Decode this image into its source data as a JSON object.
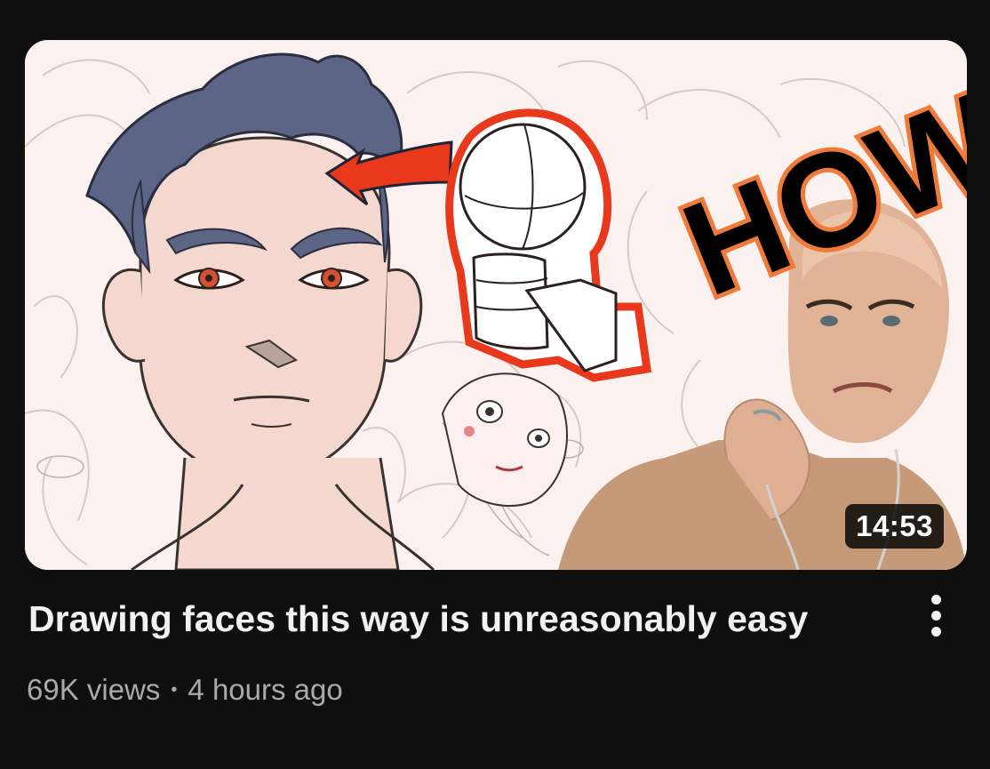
{
  "video": {
    "title": "Drawing faces this way is unreasonably easy",
    "views": "69K views",
    "separator": "•",
    "age": "4 hours ago",
    "duration": "14:53",
    "thumbnail_overlay_text": "HOW"
  },
  "icons": {
    "menu": "more-vert-icon"
  },
  "colors": {
    "background": "#0f0f0f",
    "title": "#f1f1f1",
    "meta": "#aaaaaa",
    "hair": "#5c6585",
    "accent_red": "#e8391d",
    "skin": "#f4d7cf"
  }
}
